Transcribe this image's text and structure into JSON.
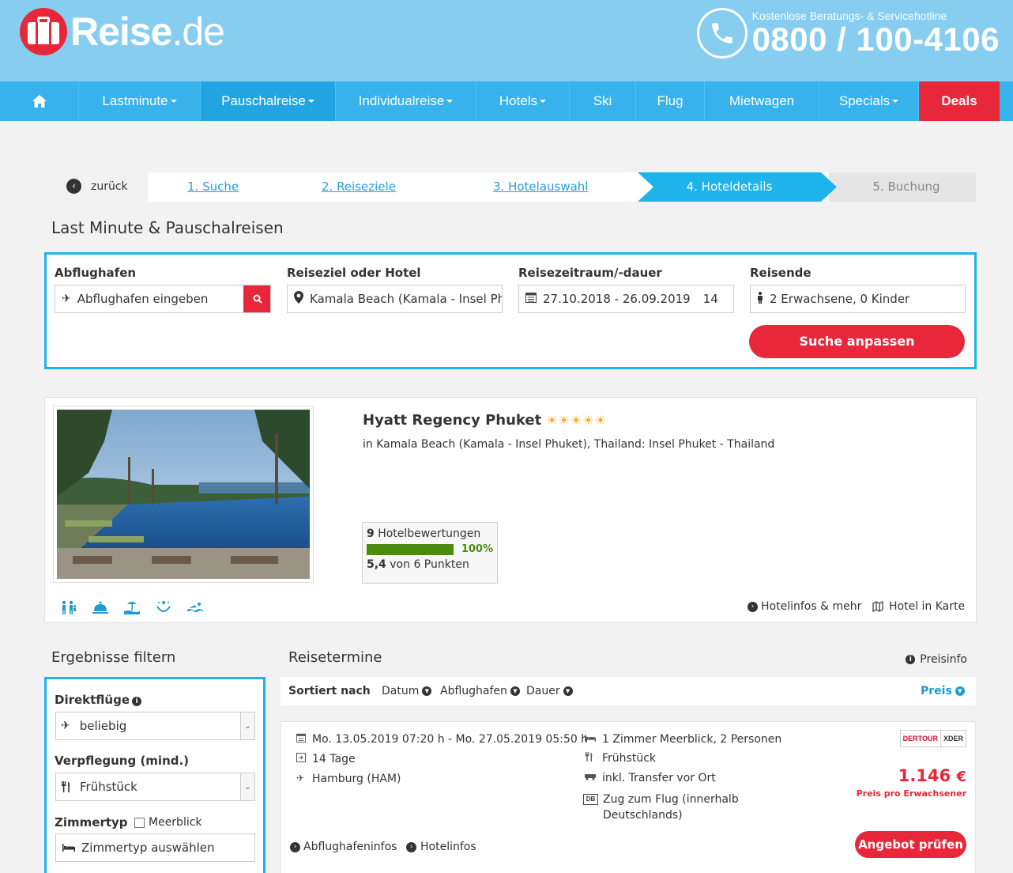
{
  "header": {
    "logo_main": "Reise",
    "logo_tld": ".de",
    "hotline_label": "Kostenlose Beratungs- & Servicehotline",
    "hotline_number": "0800 / 100-4106"
  },
  "nav": {
    "items": [
      {
        "label": "Lastminute",
        "has_caret": true
      },
      {
        "label": "Pauschalreise",
        "has_caret": true
      },
      {
        "label": "Individualreise",
        "has_caret": true
      },
      {
        "label": "Hotels",
        "has_caret": true
      },
      {
        "label": "Ski",
        "has_caret": false
      },
      {
        "label": "Flug",
        "has_caret": false
      },
      {
        "label": "Mietwagen",
        "has_caret": false
      },
      {
        "label": "Specials",
        "has_caret": true
      },
      {
        "label": "Deals",
        "has_caret": false
      }
    ]
  },
  "steps": {
    "back": "zurück",
    "s1": "1. Suche",
    "s2": "2. Reiseziele",
    "s3": "3. Hotelauswahl",
    "s4": "4. Hoteldetails",
    "s5": "5. Buchung"
  },
  "search": {
    "title": "Last Minute & Pauschalreisen",
    "airport_label": "Abflughafen",
    "airport_placeholder": "Abflughafen eingeben",
    "dest_label": "Reiseziel oder Hotel",
    "dest_value": "Kamala Beach (Kamala - Insel Phuket)",
    "date_label": "Reisezeitraum/-dauer",
    "date_value": "27.10.2018 - 26.09.2019",
    "duration_value": "14",
    "travellers_label": "Reisende",
    "travellers_value": "2 Erwachsene, 0 Kinder",
    "submit": "Suche anpassen"
  },
  "hotel": {
    "name": "Hyatt Regency Phuket",
    "stars": "☀☀☀☀☀",
    "location": "in Kamala Beach (Kamala - Insel Phuket), Thailand: Insel Phuket - Thailand",
    "reviews_count": "9",
    "reviews_label": "Hotelbewertungen",
    "recommend_pct": "100%",
    "recommend_fraction": 1.0,
    "score": "5,4",
    "score_suffix": "von 6 Punkten",
    "link_info": "Hotelinfos & mehr",
    "link_map": "Hotel in Karte"
  },
  "filter": {
    "title": "Ergebnisse filtern",
    "direct_label": "Direktflüge",
    "direct_value": "beliebig",
    "board_label": "Verpflegung (mind.)",
    "board_value": "Frühstück",
    "room_label": "Zimmertyp",
    "seaview_label": "Meerblick",
    "room_placeholder": "Zimmertyp auswählen"
  },
  "results": {
    "title": "Reisetermine",
    "price_info": "Preisinfo",
    "sorted_by": "Sortiert nach",
    "sort_date": "Datum",
    "sort_airport": "Abflughafen",
    "sort_duration": "Dauer",
    "sort_price": "Preis",
    "offer": {
      "dates": "Mo. 13.05.2019 07:20 h - Mo. 27.05.2019 05:50 h",
      "duration": "14 Tage",
      "airport": "Hamburg (HAM)",
      "room": "1 Zimmer Meerblick, 2 Personen",
      "board": "Frühstück",
      "transfer": "inkl. Transfer vor Ort",
      "train": "Zug zum Flug (innerhalb Deutschlands)",
      "price": "1.146",
      "currency": "€",
      "price_note": "Preis pro Erwachsener",
      "btn": "Angebot prüfen",
      "link_airport": "Abflughafeninfos",
      "link_hotel": "Hotelinfos",
      "operator_1": "DERTOUR",
      "operator_2": "XDER"
    }
  },
  "colors": {
    "brand_red": "#e8273a",
    "sky": "#86cdf0",
    "nav": "#37b2ea",
    "accent_blue": "#1eb3ea",
    "rating_green": "#4b8b0f"
  }
}
